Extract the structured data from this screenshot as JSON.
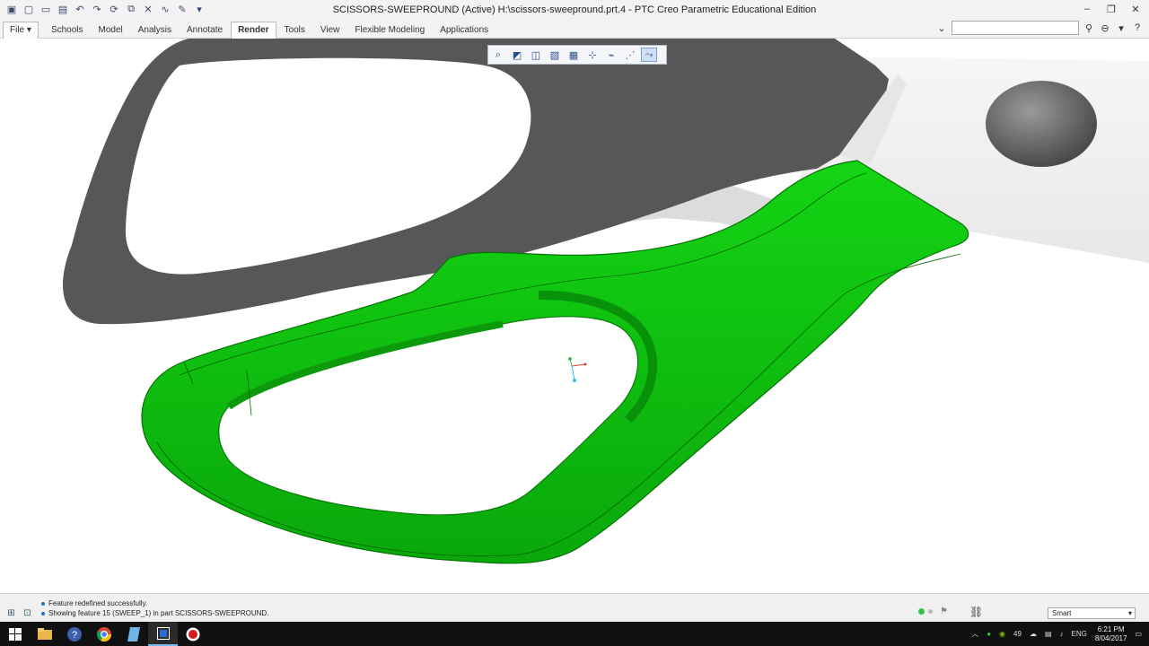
{
  "window": {
    "title": "SCISSORS-SWEEPROUND (Active) H:\\scissors-sweepround.prt.4 - PTC Creo Parametric Educational Edition"
  },
  "quick_access": [
    "new-icon",
    "open-icon",
    "save-icon",
    "undo-icon",
    "redo-icon",
    "regenerate-icon",
    "windows-icon",
    "close-icon",
    "sketch-icon",
    "customize-icon"
  ],
  "ribbon": {
    "file_label": "File",
    "tabs": [
      {
        "label": "Schools",
        "active": false
      },
      {
        "label": "Model",
        "active": false
      },
      {
        "label": "Analysis",
        "active": false
      },
      {
        "label": "Annotate",
        "active": false
      },
      {
        "label": "Render",
        "active": true
      },
      {
        "label": "Tools",
        "active": false
      },
      {
        "label": "View",
        "active": false
      },
      {
        "label": "Flexible Modeling",
        "active": false
      },
      {
        "label": "Applications",
        "active": false
      }
    ],
    "search_placeholder": ""
  },
  "view_toolbar": [
    "refit-icon",
    "zoom-in-icon",
    "zoom-out-icon",
    "repaint-icon",
    "saved-orientations-icon",
    "display-style-icon",
    "datum-display-icon",
    "annotation-display-icon",
    "spin-center-icon"
  ],
  "status": {
    "messages": [
      "Feature redefined successfully.",
      "Showing feature 15 (SWEEP_1) in part SCISSORS-SWEEPROUND."
    ],
    "filter_value": "Smart"
  },
  "taskbar": {
    "tray_number": "49",
    "language": "ENG",
    "time": "6:21 PM",
    "date": "8/04/2017"
  },
  "colors": {
    "model_green": "#11cc11",
    "background_scissors": "#5a5a5a"
  }
}
